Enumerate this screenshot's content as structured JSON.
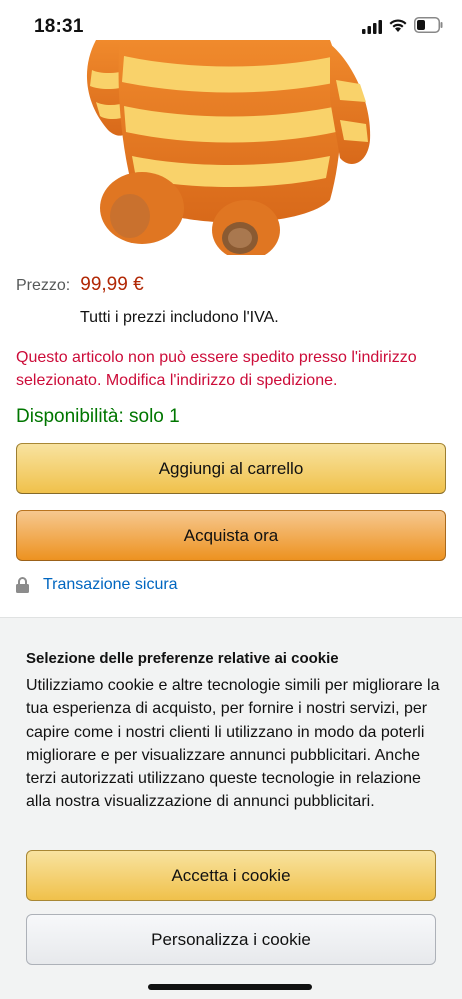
{
  "status_bar": {
    "time": "18:31",
    "icons": [
      "signal-icon",
      "wifi-icon",
      "battery-icon"
    ]
  },
  "product": {
    "image_icon": "teddy-bear-image",
    "price_label": "Prezzo:",
    "price_value": "99,99 €",
    "vat_note": "Tutti i prezzi includono l'IVA.",
    "shipping_warning": "Questo articolo non può essere spedito presso l'indirizzo selezionato. Modifica l'indirizzo di spedizione.",
    "availability": "Disponibilità: solo 1"
  },
  "actions": {
    "add_to_cart": "Aggiungi al carrello",
    "buy_now": "Acquista ora",
    "secure_transaction": "Transazione sicura"
  },
  "cookie_banner": {
    "title": "Selezione delle preferenze relative ai cookie",
    "body": "Utilizziamo cookie e altre tecnologie simili per migliorare la tua esperienza di acquisto, per fornire i nostri servizi, per capire come i nostri clienti li utilizzano in modo da poterli migliorare e per visualizzare annunci pubblicitari. Anche terzi autorizzati utilizzano queste tecnologie in relazione alla nostra visualizzazione di annunci pubblicitari.",
    "accept_label": "Accetta i cookie",
    "customize_label": "Personalizza i cookie"
  },
  "colors": {
    "price": "#b12704",
    "warning": "#cc0c39",
    "availability": "#007600",
    "link": "#0066c0",
    "cart_button": "#f0c14b",
    "buy_button": "#ed9220"
  }
}
